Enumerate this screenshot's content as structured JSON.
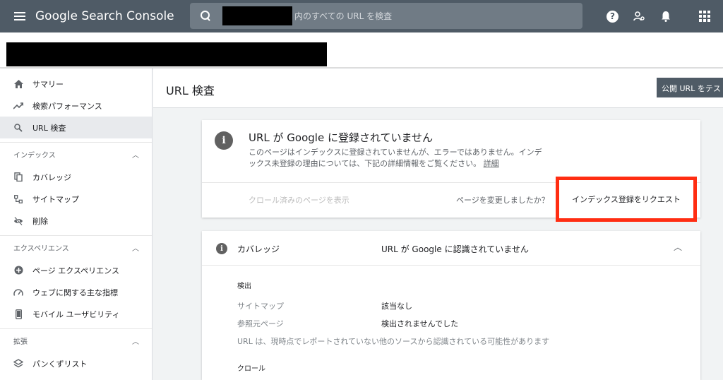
{
  "app": {
    "brand": "Google Search Console"
  },
  "search": {
    "placeholder": "内のすべての URL を検査"
  },
  "sidebar": {
    "items": [
      {
        "label": "サマリー"
      },
      {
        "label": "検索パフォーマンス"
      },
      {
        "label": "URL 検査"
      }
    ],
    "sections": [
      {
        "title": "インデックス",
        "items": [
          {
            "label": "カバレッジ"
          },
          {
            "label": "サイトマップ"
          },
          {
            "label": "削除"
          }
        ]
      },
      {
        "title": "エクスペリエンス",
        "items": [
          {
            "label": "ページ エクスペリエンス"
          },
          {
            "label": "ウェブに関する主な指標"
          },
          {
            "label": "モバイル ユーザビリティ"
          }
        ]
      },
      {
        "title": "拡張",
        "items": [
          {
            "label": "パンくずリスト"
          }
        ]
      }
    ]
  },
  "main": {
    "title": "URL 検査",
    "test_button": "公開 URL をテスト"
  },
  "status_card": {
    "title": "URL が Google に登録されていません",
    "description": "このページはインデックスに登録されていませんが、エラーではありません。インデックス未登録の理由については、下記の詳細情報をご覧ください。",
    "details_link": "詳細",
    "crawled_link": "クロール済みのページを表示",
    "changed_text": "ページを変更しましたか？",
    "request_button": "インデックス登録をリクエスト"
  },
  "coverage_card": {
    "label": "カバレッジ",
    "status": "URL が Google に認識されていません",
    "discovery_title": "検出",
    "sitemap_key": "サイトマップ",
    "sitemap_val": "該当なし",
    "referrer_key": "参照元ページ",
    "referrer_val": "検出されませんでした",
    "note": "URL は、現時点でレポートされていない他のソースから認識されている可能性があります",
    "crawl_title": "クロール"
  }
}
